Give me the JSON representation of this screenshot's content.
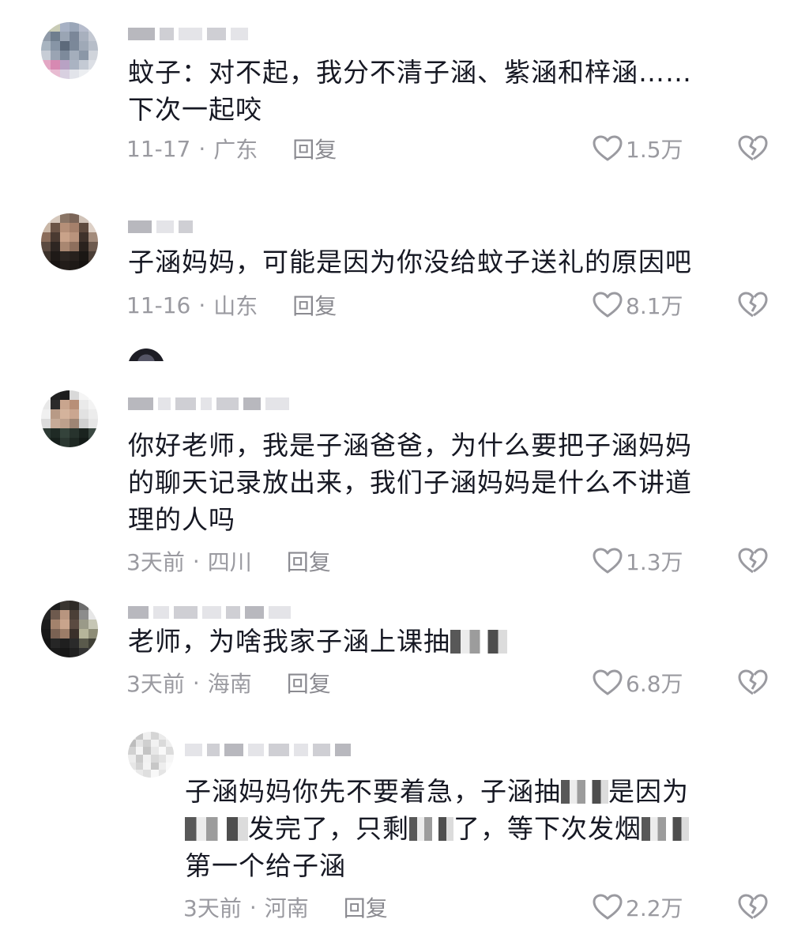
{
  "comments": [
    {
      "text": "蚊子：对不起，我分不清子涵、紫涵和梓涵……\n下次一起咬",
      "date": "11-17",
      "location": "广东",
      "reply": "回复",
      "likes": "1.5万"
    },
    {
      "text": "子涵妈妈，可能是因为你没给蚊子送礼的原因吧",
      "date": "11-16",
      "location": "山东",
      "reply": "回复",
      "likes": "8.1万"
    },
    {
      "text": "你好老师，我是子涵爸爸，为什么要把子涵妈妈\n的聊天记录放出来，我们子涵妈妈是什么不讲道\n理的人吗",
      "date": "3天前",
      "location": "四川",
      "reply": "回复",
      "likes": "1.3万"
    },
    {
      "text_before": "老师，为啥我家子涵上课抽",
      "date": "3天前",
      "location": "海南",
      "reply": "回复",
      "likes": "6.8万"
    },
    {
      "line1_a": "子涵妈妈你先不要着急，子涵抽",
      "line1_b": "是因为",
      "line2_a": "发完了，只剩",
      "line2_b": "了，等下次发烟",
      "line3": "第一个给子涵",
      "date": "3天前",
      "location": "河南",
      "reply": "回复",
      "likes": "2.2万"
    }
  ],
  "icons": {
    "like": "heart-outline-icon",
    "dislike": "broken-heart-icon",
    "censor": "mosaic-blur"
  },
  "colors": {
    "text": "#161823",
    "meta": "#9a9aa0"
  }
}
